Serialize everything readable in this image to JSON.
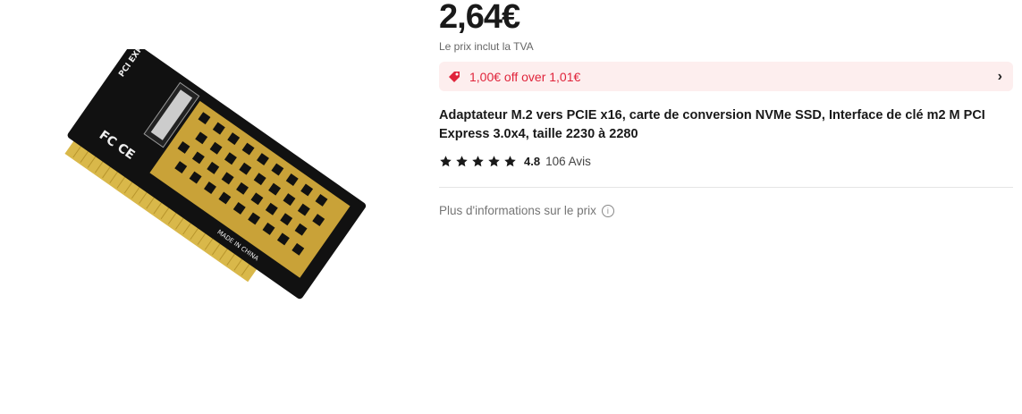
{
  "product": {
    "price": "2,64€",
    "vat_note": "Le prix inclut la TVA",
    "promo": {
      "text": "1,00€ off over 1,01€",
      "icon": "tag-icon",
      "chevron": "›"
    },
    "title": "Adaptateur M.2 vers PCIE x16, carte de conversion NVMe SSD, Interface de clé m2 M PCI Express 3.0x4, taille 2230 à 2280",
    "rating": {
      "score": "4.8",
      "reviews": "106 Avis",
      "stars": 5
    },
    "more_info": "Plus d'informations sur le prix",
    "info_icon": "ⓘ",
    "image_labels": {
      "made_in": "MADE IN CHINA",
      "pci": "PCI EXPRESS"
    }
  },
  "colors": {
    "accent": "#e0243b",
    "promo_bg": "#fdeeee"
  }
}
